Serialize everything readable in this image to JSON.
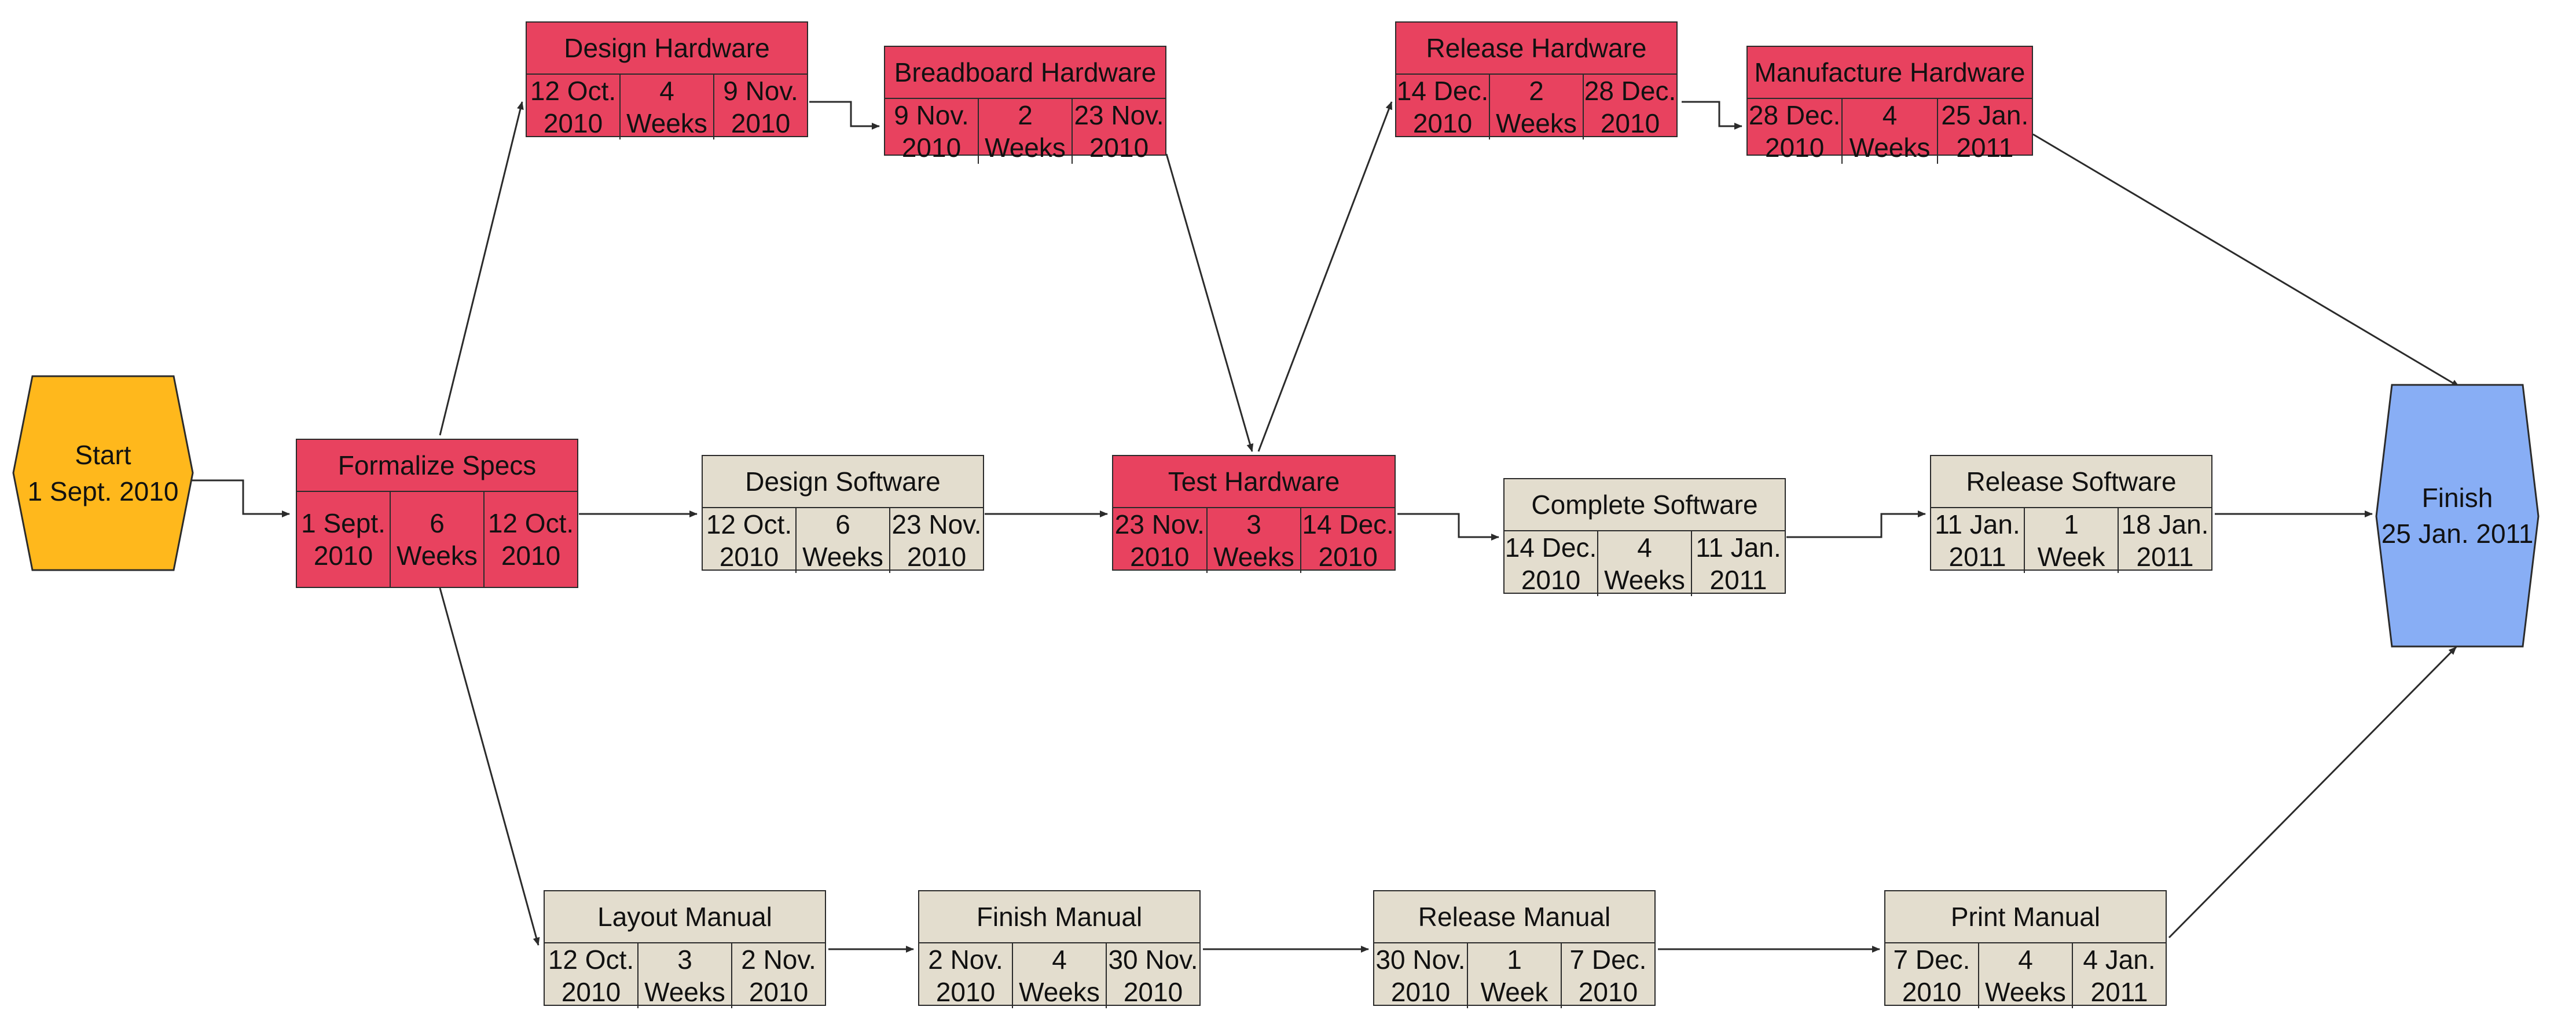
{
  "diagram": {
    "type": "pert-network-diagram",
    "colors": {
      "critical_path": "#e8425f",
      "non_critical": "#e3ddce",
      "start_node": "#ffb81c",
      "finish_node": "#88aef5",
      "edge_line": "#2b2b2b",
      "border": "#2b2b2b"
    },
    "duration_unit_plural": "Weeks",
    "duration_unit_singular": "Week"
  },
  "terminators": [
    {
      "id": "start",
      "name": "Start",
      "date": "1 Sept. 2010",
      "fill": "#ffb81c"
    },
    {
      "id": "finish",
      "name": "Finish",
      "date": "25 Jan. 2011",
      "fill": "#88aef5"
    }
  ],
  "tasks": [
    {
      "id": "formalize-specs",
      "title": "Formalize Specs",
      "start_date_line1": "1 Sept.",
      "start_date_line2": "2010",
      "duration_line1": "6",
      "duration_line2": "Weeks",
      "end_date_line1": "12 Oct.",
      "end_date_line2": "2010",
      "critical": true
    },
    {
      "id": "design-hardware",
      "title": "Design Hardware",
      "start_date_line1": "12 Oct.",
      "start_date_line2": "2010",
      "duration_line1": "4",
      "duration_line2": "Weeks",
      "end_date_line1": "9 Nov.",
      "end_date_line2": "2010",
      "critical": true
    },
    {
      "id": "breadboard-hardware",
      "title": "Breadboard Hardware",
      "start_date_line1": "9 Nov.",
      "start_date_line2": "2010",
      "duration_line1": "2",
      "duration_line2": "Weeks",
      "end_date_line1": "23 Nov.",
      "end_date_line2": "2010",
      "critical": true
    },
    {
      "id": "release-hardware",
      "title": "Release Hardware",
      "start_date_line1": "14 Dec.",
      "start_date_line2": "2010",
      "duration_line1": "2",
      "duration_line2": "Weeks",
      "end_date_line1": "28 Dec.",
      "end_date_line2": "2010",
      "critical": true
    },
    {
      "id": "manufacture-hardware",
      "title": "Manufacture Hardware",
      "start_date_line1": "28 Dec.",
      "start_date_line2": "2010",
      "duration_line1": "4",
      "duration_line2": "Weeks",
      "end_date_line1": "25 Jan.",
      "end_date_line2": "2011",
      "critical": true
    },
    {
      "id": "design-software",
      "title": "Design Software",
      "start_date_line1": "12 Oct.",
      "start_date_line2": "2010",
      "duration_line1": "6",
      "duration_line2": "Weeks",
      "end_date_line1": "23 Nov.",
      "end_date_line2": "2010",
      "critical": false
    },
    {
      "id": "test-hardware",
      "title": "Test Hardware",
      "start_date_line1": "23 Nov.",
      "start_date_line2": "2010",
      "duration_line1": "3",
      "duration_line2": "Weeks",
      "end_date_line1": "14 Dec.",
      "end_date_line2": "2010",
      "critical": true
    },
    {
      "id": "complete-software",
      "title": "Complete Software",
      "start_date_line1": "14 Dec.",
      "start_date_line2": "2010",
      "duration_line1": "4",
      "duration_line2": "Weeks",
      "end_date_line1": "11 Jan.",
      "end_date_line2": "2011",
      "critical": false
    },
    {
      "id": "release-software",
      "title": "Release Software",
      "start_date_line1": "11 Jan.",
      "start_date_line2": "2011",
      "duration_line1": "1",
      "duration_line2": "Week",
      "end_date_line1": "18 Jan.",
      "end_date_line2": "2011",
      "critical": false
    },
    {
      "id": "layout-manual",
      "title": "Layout Manual",
      "start_date_line1": "12 Oct.",
      "start_date_line2": "2010",
      "duration_line1": "3",
      "duration_line2": "Weeks",
      "end_date_line1": "2 Nov.",
      "end_date_line2": "2010",
      "critical": false
    },
    {
      "id": "finish-manual",
      "title": "Finish Manual",
      "start_date_line1": "2 Nov.",
      "start_date_line2": "2010",
      "duration_line1": "4",
      "duration_line2": "Weeks",
      "end_date_line1": "30 Nov.",
      "end_date_line2": "2010",
      "critical": false
    },
    {
      "id": "release-manual",
      "title": "Release Manual",
      "start_date_line1": "30 Nov.",
      "start_date_line2": "2010",
      "duration_line1": "1",
      "duration_line2": "Week",
      "end_date_line1": "7 Dec.",
      "end_date_line2": "2010",
      "critical": false
    },
    {
      "id": "print-manual",
      "title": "Print Manual",
      "start_date_line1": "7 Dec.",
      "start_date_line2": "2010",
      "duration_line1": "4",
      "duration_line2": "Weeks",
      "end_date_line1": "4 Jan.",
      "end_date_line2": "2011",
      "critical": false
    }
  ]
}
